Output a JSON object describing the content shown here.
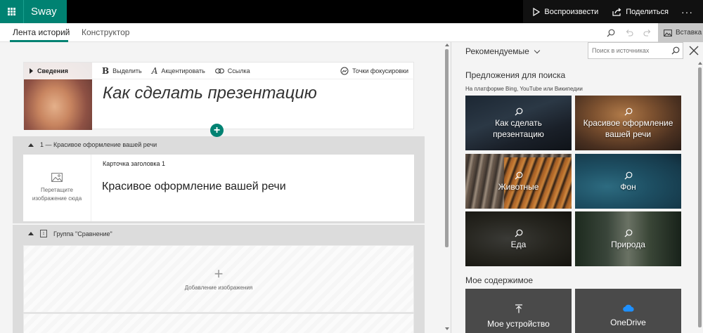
{
  "app": {
    "name": "Sway"
  },
  "topbar": {
    "play_label": "Воспроизвести",
    "share_label": "Поделиться",
    "more_label": "···"
  },
  "tabs": [
    {
      "label": "Лента историй",
      "active": true
    },
    {
      "label": "Конструктор",
      "active": false
    }
  ],
  "toolbar": {
    "insert_label": "Вставка"
  },
  "title_card": {
    "thumb_label": "Сведения",
    "format": {
      "bold": "Выделить",
      "accent": "Акцентировать",
      "link": "Ссылка",
      "focus": "Точки фокусировки"
    },
    "title": "Как сделать презентацию"
  },
  "section1": {
    "header": "1 — Красивое оформление вашей речи",
    "image_drop": "Перетащите изображение сюда",
    "card_label": "Карточка заголовка 1",
    "heading": "Красивое оформление вашей речи"
  },
  "section2": {
    "header": "Группа \"Сравнение\"",
    "add_image": "Добавление изображения"
  },
  "pane": {
    "recommended": "Рекомендуемые",
    "search_placeholder": "Поиск в источниках",
    "suggestions_title": "Предложения для поиска",
    "suggestions_sub": "На платформе Bing, YouTube или Википедии",
    "tiles": [
      "Как сделать презентацию",
      "Красивое оформление вашей речи",
      "Животные",
      "Фон",
      "Еда",
      "Природа"
    ],
    "my_content_title": "Мое содержимое",
    "my_content": [
      "Мое устройство",
      "OneDrive"
    ]
  },
  "colors": {
    "brand": "#008272",
    "topbar": "#000000",
    "onedrive": "#1e90ff"
  }
}
